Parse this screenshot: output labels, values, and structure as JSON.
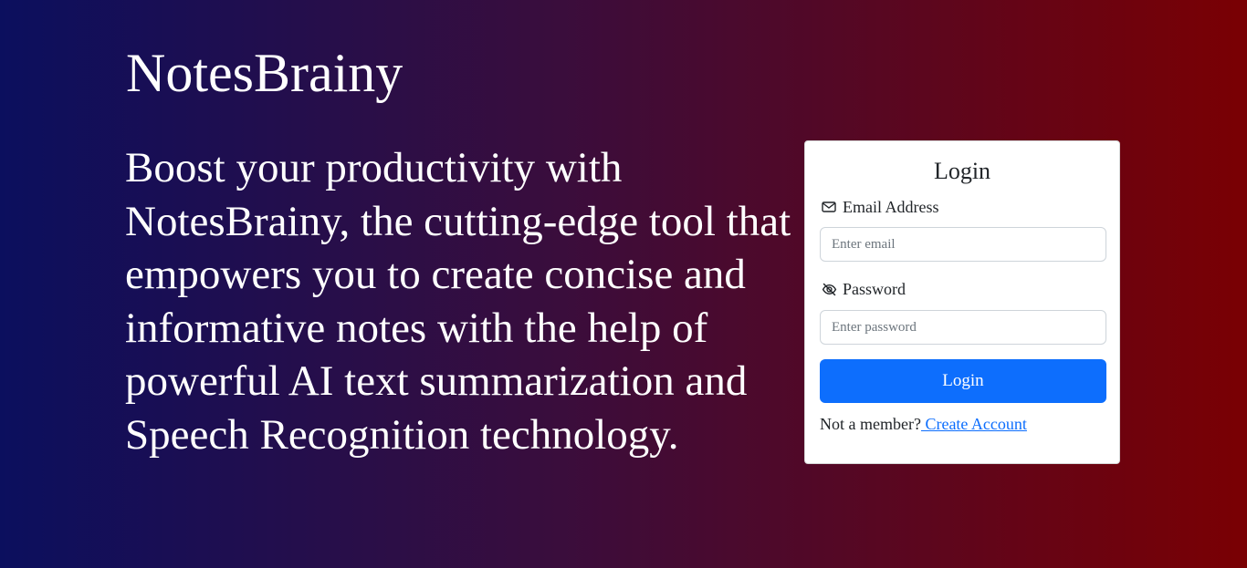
{
  "brand": {
    "name": "NotesBrainy"
  },
  "hero": {
    "tagline": "Boost your productivity with NotesBrainy, the cutting-edge tool that empowers you to create concise and informative notes with the help of powerful AI text summarization and Speech Recognition technology."
  },
  "login_form": {
    "title": "Login",
    "email": {
      "label": "Email Address",
      "icon": "envelope-icon",
      "value": "",
      "placeholder": "Enter email"
    },
    "password": {
      "label": "Password",
      "icon": "eye-slash-icon",
      "value": "",
      "placeholder": "Enter password"
    },
    "submit_label": "Login",
    "signup_prompt": "Not a member?",
    "signup_link": " Create Account"
  },
  "colors": {
    "gradient_start": "#0b0f5e",
    "gradient_end": "#7a0003",
    "primary_button": "#0d6efd",
    "link": "#0d6efd"
  }
}
